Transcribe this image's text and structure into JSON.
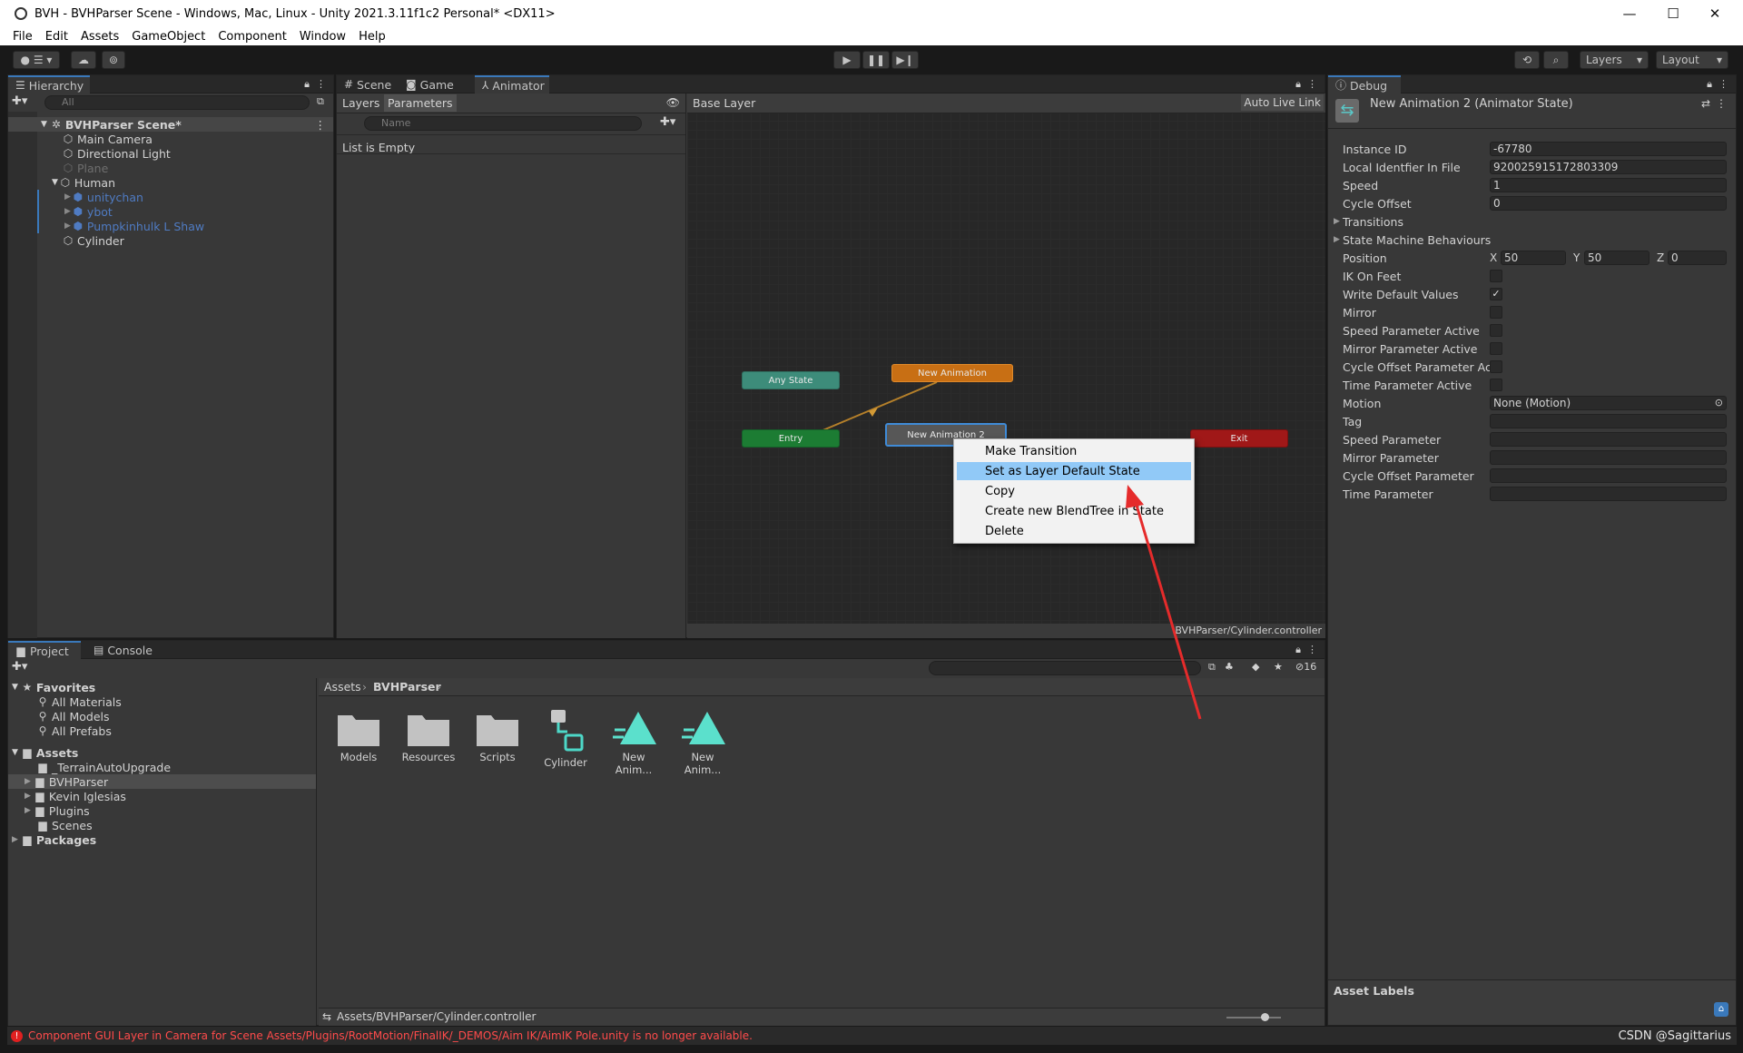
{
  "window": {
    "title": "BVH - BVHParser Scene - Windows, Mac, Linux - Unity 2021.3.11f1c2 Personal* <DX11>",
    "controls": {
      "minimize": "—",
      "maximize": "☐",
      "close": "✕"
    }
  },
  "menu": [
    "File",
    "Edit",
    "Assets",
    "GameObject",
    "Component",
    "Window",
    "Help"
  ],
  "toolbar": {
    "layers_label": "Layers",
    "layout_label": "Layout"
  },
  "hierarchy": {
    "tab_label": "Hierarchy",
    "search_placeholder": "All",
    "scene_name": "BVHParser Scene*",
    "items": [
      {
        "label": "Main Camera"
      },
      {
        "label": "Directional Light"
      },
      {
        "label": "Plane"
      },
      {
        "label": "Human"
      },
      {
        "label": "unitychan"
      },
      {
        "label": "ybot"
      },
      {
        "label": "Pumpkinhulk L Shaw"
      },
      {
        "label": "Cylinder"
      }
    ]
  },
  "center_tabs": [
    "Scene",
    "Game",
    "Animator"
  ],
  "animator": {
    "layers_label": "Layers",
    "parameters_label": "Parameters",
    "name_placeholder": "Name",
    "list_empty": "List is Empty",
    "breadcrumb": "Base Layer",
    "auto_live_link": "Auto Live Link",
    "footer_path": "BVHParser/Cylinder.controller",
    "nodes": {
      "any_state": "Any State",
      "new_animation": "New Animation",
      "entry": "Entry",
      "new_animation_2": "New Animation 2",
      "exit": "Exit"
    },
    "context_menu": [
      "Make Transition",
      "Set as Layer Default State",
      "Copy",
      "Create new BlendTree in State",
      "Delete"
    ]
  },
  "inspector": {
    "tab_label": "Debug",
    "header": "New Animation 2 (Animator State)",
    "rows": [
      {
        "label": "Instance ID",
        "value": "-67780"
      },
      {
        "label": "Local Identfier In File",
        "value": "9200259151728033​09"
      },
      {
        "label": "Speed",
        "value": "1"
      },
      {
        "label": "Cycle Offset",
        "value": "0"
      }
    ],
    "foldouts": [
      "Transitions",
      "State Machine Behaviours"
    ],
    "position": {
      "label": "Position",
      "x": "50",
      "y": "50",
      "z": "0"
    },
    "toggles": [
      {
        "label": "IK On Feet",
        "checked": false
      },
      {
        "label": "Write Default Values",
        "checked": true
      },
      {
        "label": "Mirror",
        "checked": false
      },
      {
        "label": "Speed Parameter Active",
        "checked": false
      },
      {
        "label": "Mirror Parameter Active",
        "checked": false
      },
      {
        "label": "Cycle Offset Parameter Activ",
        "checked": false
      },
      {
        "label": "Time Parameter Active",
        "checked": false
      }
    ],
    "motion": {
      "label": "Motion",
      "value": "None (Motion)"
    },
    "empty_fields": [
      "Tag",
      "Speed Parameter",
      "Mirror Parameter",
      "Cycle Offset Parameter",
      "Time Parameter"
    ],
    "asset_labels": "Asset Labels"
  },
  "project": {
    "tabs": [
      "Project",
      "Console"
    ],
    "favorites_label": "Favorites",
    "favorites": [
      "All Materials",
      "All Models",
      "All Prefabs"
    ],
    "assets_label": "Assets",
    "assets_folders": [
      "_TerrainAutoUpgrade",
      "BVHParser",
      "Kevin Iglesias",
      "Plugins",
      "Scenes"
    ],
    "packages_label": "Packages",
    "breadcrumb": [
      "Assets",
      "BVHParser"
    ],
    "items": [
      "Models",
      "Resources",
      "Scripts",
      "Cylinder",
      "New Anim...",
      "New Anim..."
    ],
    "selected_path": "Assets/BVHParser/Cylinder.controller",
    "hidden_count": "16"
  },
  "status": {
    "message": "Component GUI Layer in Camera for Scene Assets/Plugins/RootMotion/FinalIK/_DEMOS/Aim IK/AimIK Pole.unity is no longer available.",
    "watermark": "CSDN @Sagittarius"
  },
  "colors": {
    "accent": "#3a79bb",
    "error": "#ff4b4b",
    "selection": "#91c9f7"
  }
}
